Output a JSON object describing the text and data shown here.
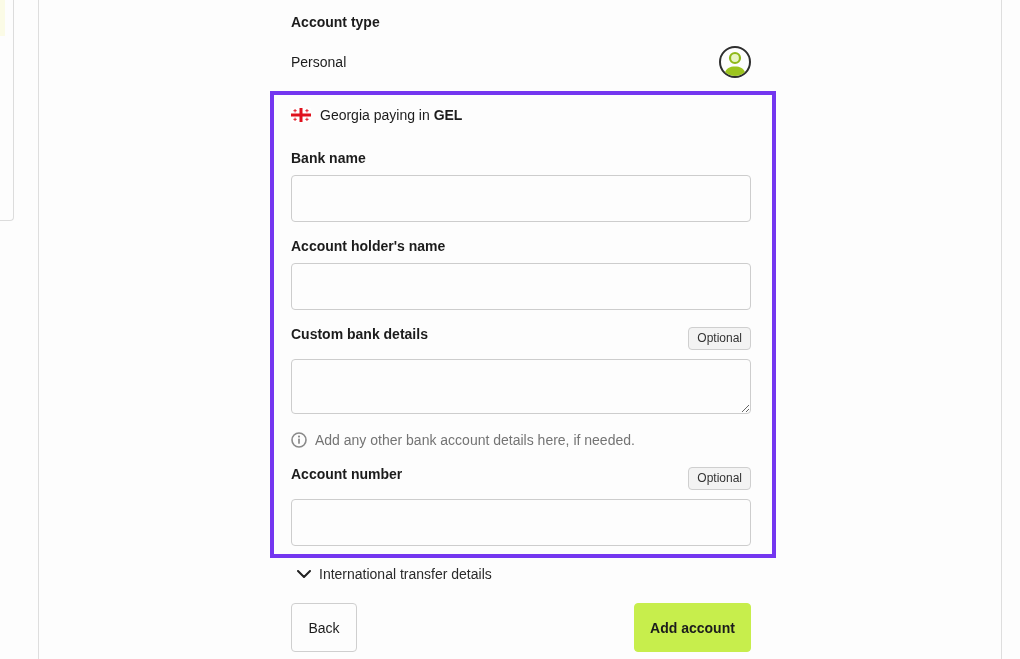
{
  "account_type": {
    "label": "Account type",
    "value": "Personal"
  },
  "bank_form": {
    "highlighted": true,
    "country_currency": "Georgia paying in **GEL**",
    "fields": [
      {
        "label": "Bank name",
        "kind": "input"
      },
      {
        "label": "Account holder's name",
        "kind": "input"
      },
      {
        "label": "Custom bank details",
        "kind": "textarea",
        "badge": "Optional",
        "hint": "Add any other bank account details here, if needed."
      },
      {
        "label": "Account number",
        "kind": "input",
        "badge": "Optional"
      }
    ]
  },
  "international_transfer": {
    "label": "International transfer details",
    "expanded": false
  },
  "buttons": [
    {
      "label": "Back",
      "kind": "secondary"
    },
    {
      "label": "Add account",
      "kind": "primary"
    }
  ]
}
